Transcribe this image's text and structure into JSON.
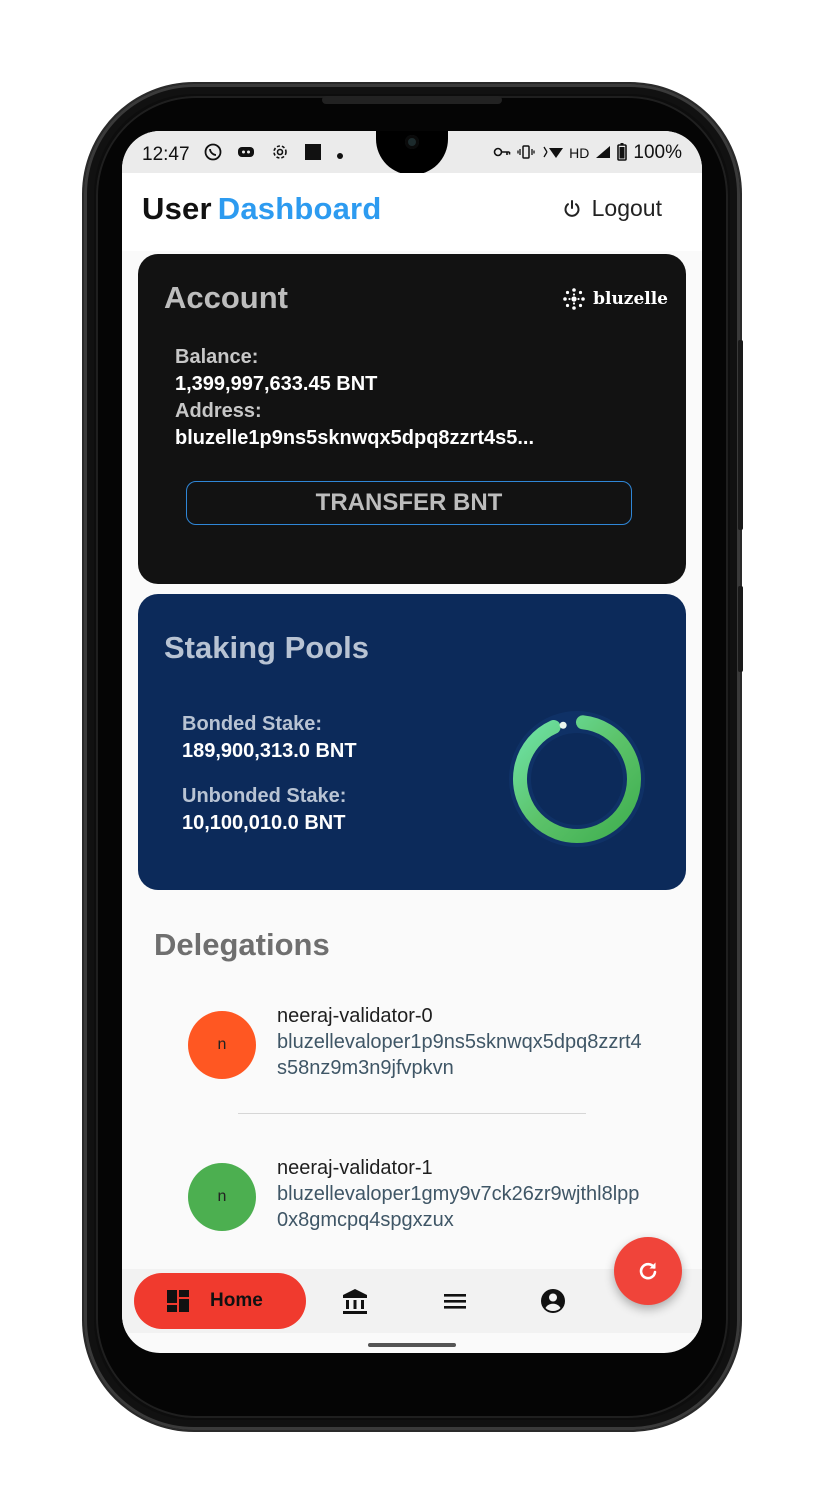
{
  "status_bar": {
    "time": "12:47",
    "network": "HD",
    "battery": "100%"
  },
  "header": {
    "title_part1": "User",
    "title_part2": "Dashboard",
    "logout_label": "Logout",
    "accent_color": "#2d9bf0"
  },
  "account_card": {
    "title": "Account",
    "brand": "bluzelle",
    "balance_label": "Balance:",
    "balance_value": "1,399,997,633.45 BNT",
    "address_label": "Address:",
    "address_value": "bluzelle1p9ns5sknwqx5dpq8zzrt4s5...",
    "transfer_button": "TRANSFER BNT"
  },
  "staking_card": {
    "title": "Staking Pools",
    "bonded_label": "Bonded Stake:",
    "bonded_value": "189,900,313.0 BNT",
    "unbonded_label": "Unbonded Stake:",
    "unbonded_value": "10,100,010.0 BNT",
    "bonded_fraction": 0.9495
  },
  "delegations": {
    "title": "Delegations",
    "items": [
      {
        "avatar_letter": "n",
        "avatar_color": "#ff5722",
        "name": "neeraj-validator-0",
        "address": "bluzellevaloper1p9ns5sknwqx5dpq8zzrt4s58nz9m3n9jfvpkvn"
      },
      {
        "avatar_letter": "n",
        "avatar_color": "#4caf50",
        "name": "neeraj-validator-1",
        "address": "bluzellevaloper1gmy9v7ck26zr9wjthl8lpp0x8gmcpq4spgxzux"
      }
    ]
  },
  "bottom_nav": {
    "home_label": "Home",
    "items": [
      "home-icon",
      "bank-icon",
      "menu-icon",
      "account-circle-icon"
    ],
    "fab_icon": "refresh-icon",
    "active_color": "#f03a2e"
  }
}
